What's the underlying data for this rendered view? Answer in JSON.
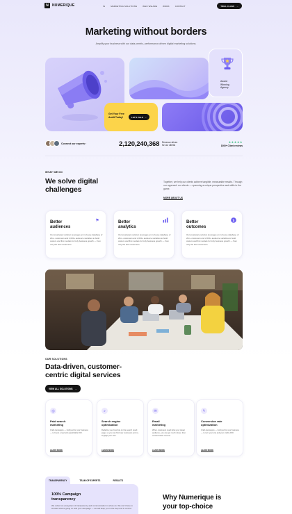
{
  "nav": {
    "logo_mark": "N",
    "logo_text": "NUMERIQUE",
    "links": [
      "IN",
      "MARKETING SOLUTIONS",
      "WHO WE ARE",
      "WORK",
      "CONTACT"
    ],
    "cta_label": "TRIAL CLASS"
  },
  "hero": {
    "title": "Marketing without borders",
    "subtitle": "Amplify your business with our data-centric, performance-driven digital marketing solutions.",
    "award_lines": [
      "Award",
      "Winning",
      "Agency"
    ],
    "cta_text": [
      "Get Your Free",
      "Audit Today!"
    ],
    "cta_button": "LET'S TALK"
  },
  "stats": {
    "connect_label": "Connect our experts",
    "big_number": "2,120,240,368",
    "big_label": [
      "Revenue driven",
      "for our clients"
    ],
    "stars": "★★★★★",
    "reviews": "1000+ Client reviews"
  },
  "what_we_do": {
    "eyebrow": "WHAT WE DO",
    "title": [
      "We solve digital",
      "challenges"
    ],
    "side_text": "Together, we help our clients achieve tangible, measurable results. Through our approach our clients — spanning a unique perspective and skills to the game.",
    "side_link": "MORE ABOUT US",
    "features": [
      {
        "title": [
          "Better",
          "audiences"
        ],
        "icon": "flag-icon",
        "body": "Our proprietary solution leverages an in-house database of 2bn+ customers and 2,000+ audience variables to build custom and first models for truly business growth — from only the best customers."
      },
      {
        "title": [
          "Better",
          "analytics"
        ],
        "icon": "chart-icon",
        "body": "Our proprietary solution leverages an in-house database of 2bn+ customers and 2,000+ audience variables to build custom and first models for truly business growth — from only the best customers."
      },
      {
        "title": [
          "Better",
          "outcomes"
        ],
        "icon": "dollar-icon",
        "body": "Our proprietary solution leverages an in-house database of 2bn+ customers and 2,000+ audience variables to build custom and first models for truly business growth — from only the best customers."
      }
    ]
  },
  "solutions": {
    "eyebrow": "OUR SOLUTIONS",
    "title": [
      "Data-driven, customer-",
      "centric digital services"
    ],
    "button": "VIEW ALL SOLUTIONS",
    "cards": [
      {
        "title": [
          "Paid search",
          "marketing"
        ],
        "icon": "target-icon",
        "body": "Craft campaigns — built just for your business — to boost a real and quantifiable ROI.",
        "link": "LEARN MORE"
      },
      {
        "title": [
          "Search engine",
          "optimization"
        ],
        "icon": "search-icon",
        "body": "Redefine your best bet on the search result page, so you can find new customers and re-engage your own.",
        "link": "LEARN MORE"
      },
      {
        "title": [
          "Email",
          "marketing"
        ],
        "icon": "mail-icon",
        "body": "When customers need what your target audience, you can get much closer, then convert better income.",
        "link": "LEARN MORE"
      },
      {
        "title": [
          "Conversion rate",
          "optimization"
        ],
        "icon": "bolt-icon",
        "body": "Craft campaigns — built just for your business — to turn your site and your visible ROI.",
        "link": "LEARN MORE"
      }
    ]
  },
  "bottom": {
    "tabs": [
      "TRANSPARENCY",
      "TEAM OF EXPERTS",
      "RESULTS"
    ],
    "panel_title": [
      "100% Campaign",
      "transparency"
    ],
    "panel_body": "We collect an ecosystem of transparency and communication in all we do. We don't have to wonder what is going on with your campaign — we will keep you in the loop and in control.",
    "why_title": [
      "Why Numerique is",
      "your top-choice"
    ]
  },
  "colors": {
    "accent": "#6a5cf0",
    "yellow": "#fcd44a",
    "lavender": "#e6e3fc",
    "dark": "#141414",
    "star_green": "#2bb673"
  }
}
